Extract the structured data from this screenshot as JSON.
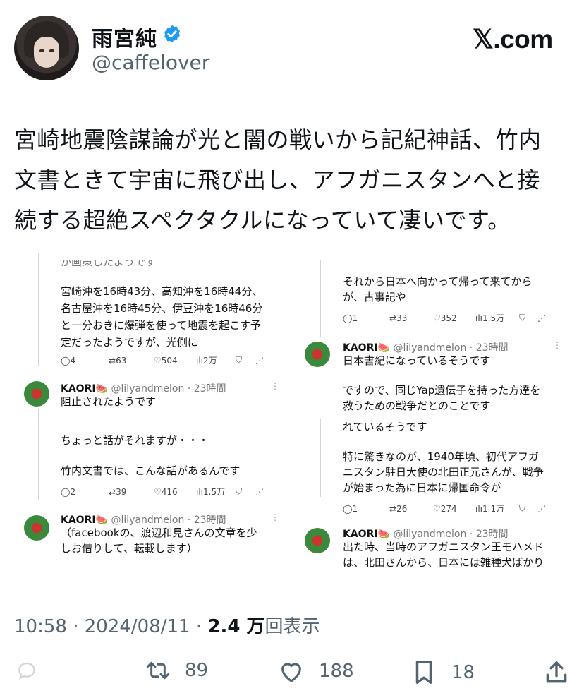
{
  "author": {
    "name": "雨宮純",
    "handle": "@caffelover",
    "verified_color": "#1d9bf0"
  },
  "brand": "𝕏.com",
  "tweet": {
    "lines": [
      "宮崎地震陰謀論が光と闇の戦いから記紀神話、竹内",
      "文書ときて宇宙に飛び出し、アフガニスタンへと接",
      "続する超絶スペクタクルになっていて凄いです。"
    ]
  },
  "embed": {
    "left": {
      "top_cut": "が画策したようです",
      "post1": [
        "宮崎沖を16時43分、高知沖を16時44分、",
        "名古屋沖を16時45分、伊豆沖を16時46分",
        "と一分おきに爆弾を使って地震を起こす予",
        "定だったようですが、光側に"
      ],
      "metrics1": {
        "replies": "4",
        "retweets": "63",
        "likes": "504",
        "views": "2万"
      },
      "reply1": {
        "name": "KAORI🍉",
        "handle": "@lilyandmelon · 23時間",
        "text": "阻止されたようです"
      },
      "post2": [
        "ちょっと話がそれますが・・・",
        "",
        "竹内文書では、こんな話があるんです"
      ],
      "metrics2": {
        "replies": "2",
        "retweets": "39",
        "likes": "416",
        "views": "1.5万"
      },
      "reply2": {
        "name": "KAORI🍉",
        "handle": "@lilyandmelon · 23時間",
        "lines": [
          "（facebookの、渡辺和見さんの文章を少",
          "しお借りして、転載します）"
        ]
      }
    },
    "right": {
      "post1": [
        "それから日本へ向かって帰って来てから",
        "が、古事記や"
      ],
      "metrics1": {
        "replies": "1",
        "retweets": "33",
        "likes": "352",
        "views": "1.5万"
      },
      "reply1": {
        "name": "KAORI🍉",
        "handle": "@lilyandmelon · 23時間",
        "text": "日本書紀になっているそうです"
      },
      "post2": [
        "ですので、同じYap遺伝子を持った方達を",
        "救うための戦争だとのことです"
      ],
      "post3": [
        "れているそうです",
        "",
        "特に驚きなのが、1940年頃、初代アフガ",
        "ニスタン駐日大使の北田正元さんが、戦争",
        "が始まった為に日本に帰国命令が"
      ],
      "metrics2": {
        "replies": "1",
        "retweets": "26",
        "likes": "274",
        "views": "1.1万"
      },
      "reply2": {
        "name": "KAORI🍉",
        "handle": "@lilyandmelon · 23時間",
        "lines": [
          "出た時、当時のアフガニスタン王モハメド",
          "は、北田さんから、日本には雑種犬ばかり"
        ]
      }
    }
  },
  "meta": {
    "time": "10:58 · 2024/08/11 · ",
    "views_count": "2.4 万",
    "views_label": "回表示"
  },
  "actions": {
    "retweets": "89",
    "likes": "188",
    "bookmarks": "18"
  }
}
